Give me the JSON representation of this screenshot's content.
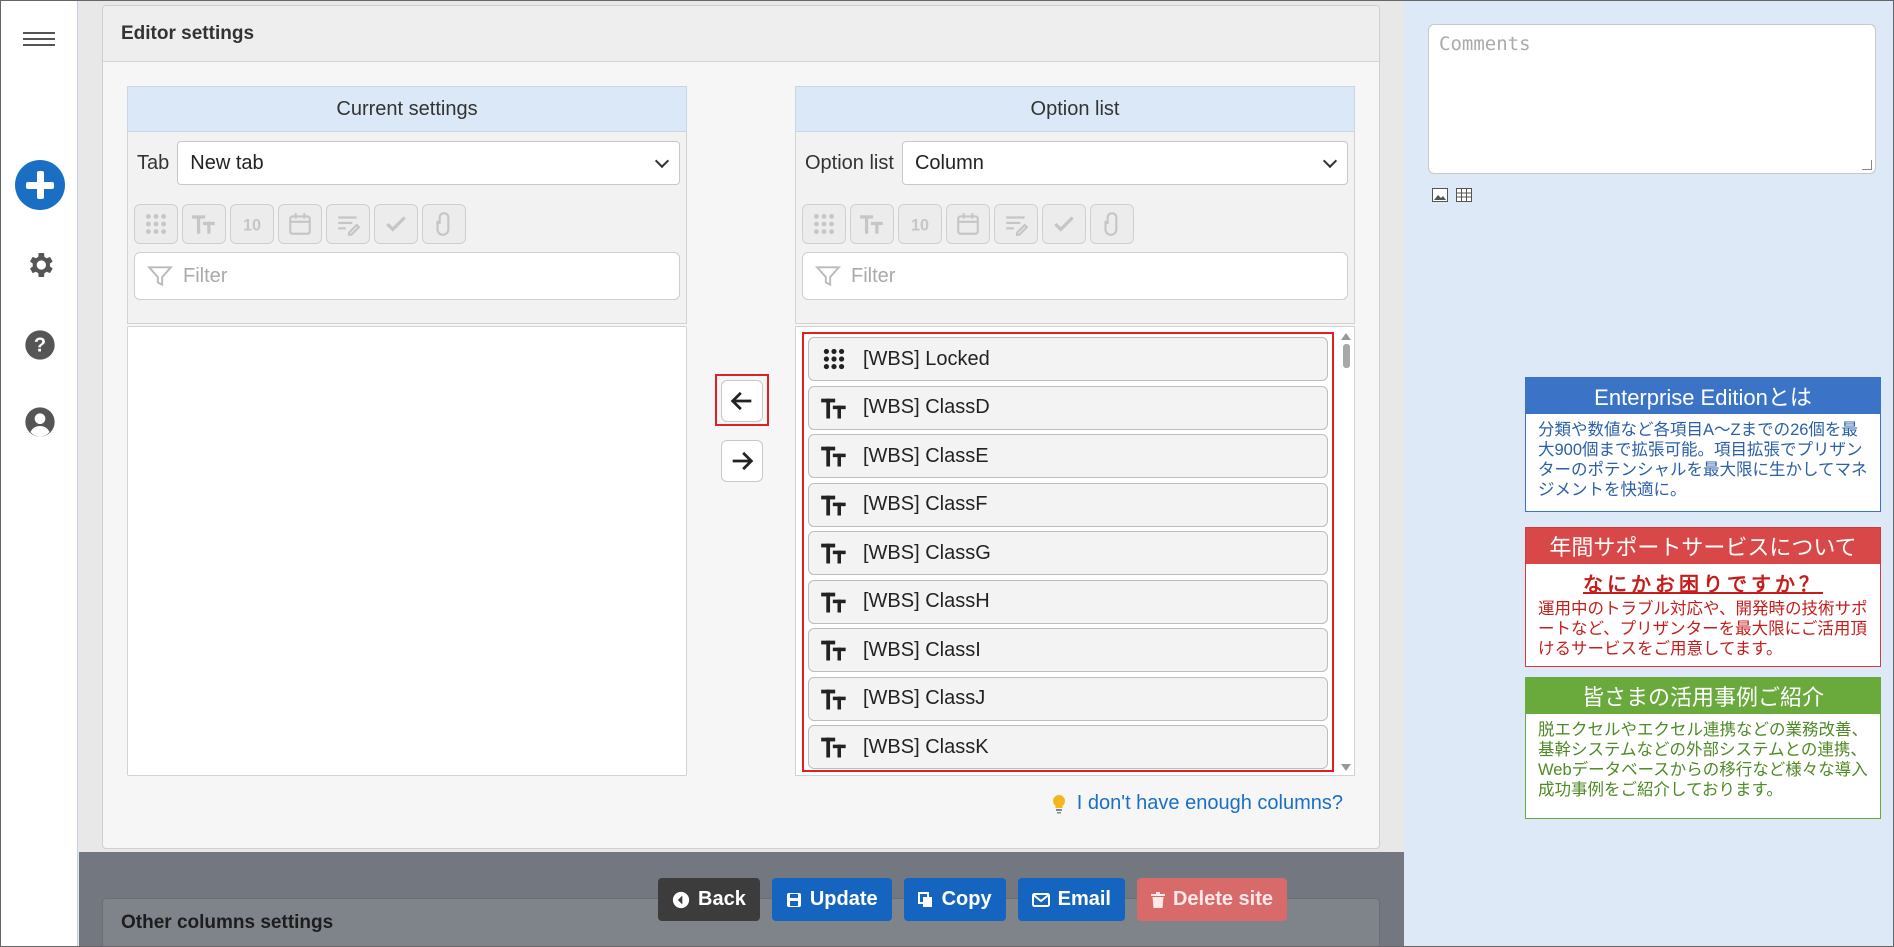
{
  "editor": {
    "title": "Editor settings",
    "current": {
      "header": "Current settings",
      "tab_label": "Tab",
      "tab_value": "New tab",
      "filter_placeholder": "Filter"
    },
    "options": {
      "header": "Option list",
      "list_label": "Option list",
      "list_value": "Column",
      "filter_placeholder": "Filter",
      "items": [
        {
          "label": "[WBS] Locked",
          "icon": "grid-dots-icon"
        },
        {
          "label": "[WBS] ClassD",
          "icon": "text-type-icon"
        },
        {
          "label": "[WBS] ClassE",
          "icon": "text-type-icon"
        },
        {
          "label": "[WBS] ClassF",
          "icon": "text-type-icon"
        },
        {
          "label": "[WBS] ClassG",
          "icon": "text-type-icon"
        },
        {
          "label": "[WBS] ClassH",
          "icon": "text-type-icon"
        },
        {
          "label": "[WBS] ClassI",
          "icon": "text-type-icon"
        },
        {
          "label": "[WBS] ClassJ",
          "icon": "text-type-icon"
        },
        {
          "label": "[WBS] ClassK",
          "icon": "text-type-icon"
        }
      ]
    },
    "help_link": "I don't have enough columns?"
  },
  "other_panel_title": "Other columns settings",
  "buttons": {
    "back": "Back",
    "update": "Update",
    "copy": "Copy",
    "email": "Email",
    "delete": "Delete site"
  },
  "comments_placeholder": "Comments",
  "promos": {
    "enterprise": {
      "title": "Enterprise Editionとは",
      "body": "分類や数値など各項目A～Zまでの26個を最大900個まで拡張可能。項目拡張でプリザンターのポテンシャルを最大限に生かしてマネジメントを快適に。"
    },
    "support": {
      "title": "年間サポートサービスについて",
      "subtitle": "なにかお困りですか？",
      "body": "運用中のトラブル対応や、開発時の技術サポートなど、プリザンターを最大限にご活用頂けるサービスをご用意してます。"
    },
    "cases": {
      "title": "皆さまの活用事例ご紹介",
      "body": "脱エクセルやエクセル連携などの業務改善、基幹システムなどの外部システムとの連携、Webデータベースからの移行など様々な導入成功事例をご紹介しております。"
    }
  },
  "colors": {
    "primary": "#1565c0",
    "highlight": "#e02020",
    "enterprise": "#3b74c7",
    "support": "#d84848",
    "cases": "#6aa93b"
  }
}
